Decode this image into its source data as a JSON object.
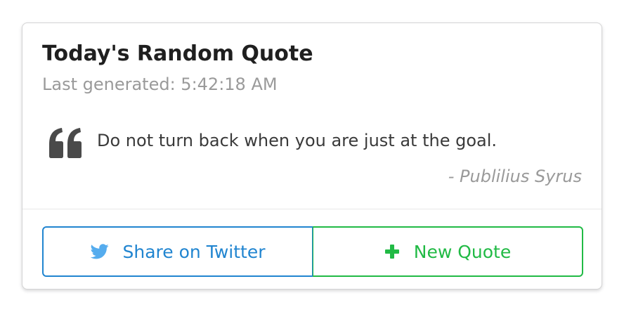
{
  "card": {
    "title": "Today's Random Quote",
    "meta": "Last generated: 5:42:18 AM"
  },
  "quote": {
    "icon": "quote-left-icon",
    "text": "Do not turn back when you are just at the goal.",
    "author": "- Publilius Syrus"
  },
  "actions": {
    "share": {
      "label": "Share on Twitter",
      "icon": "twitter-icon",
      "color": "#2185d0"
    },
    "new_quote": {
      "label": "New Quote",
      "icon": "plus-icon",
      "color": "#21ba45"
    }
  }
}
